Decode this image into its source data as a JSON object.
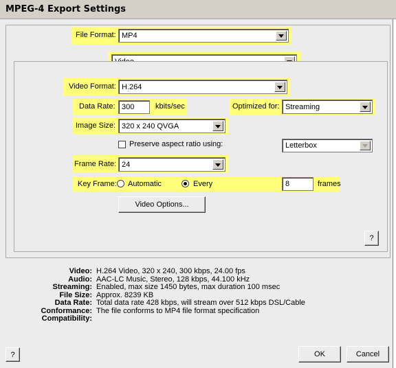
{
  "window": {
    "title": "MPEG-4 Export Settings"
  },
  "file_format": {
    "label": "File Format:",
    "value": "MP4"
  },
  "section": {
    "value": "Video"
  },
  "video_format": {
    "label": "Video Format:",
    "value": "H.264"
  },
  "data_rate": {
    "label": "Data Rate:",
    "value": "300",
    "unit": "kbits/sec"
  },
  "optimized_for": {
    "label": "Optimized for:",
    "value": "Streaming"
  },
  "image_size": {
    "label": "Image Size:",
    "value": "320 x 240 QVGA"
  },
  "preserve_aspect": {
    "label": "Preserve aspect ratio using:",
    "checked": false,
    "value": "Letterbox"
  },
  "frame_rate": {
    "label": "Frame Rate:",
    "value": "24"
  },
  "key_frame": {
    "label": "Key Frame:",
    "automatic": "Automatic",
    "every": "Every",
    "selected": "every",
    "value": "8",
    "unit": "frames"
  },
  "buttons": {
    "video_options": "Video Options...",
    "help": "?",
    "ok": "OK",
    "cancel": "Cancel"
  },
  "summary": [
    {
      "key": "Video:",
      "value": "H.264 Video, 320 x 240, 300 kbps, 24.00 fps"
    },
    {
      "key": "Audio:",
      "value": "AAC-LC Music, Stereo, 128 kbps, 44.100 kHz"
    },
    {
      "key": "Streaming:",
      "value": "Enabled, max size 1450 bytes, max duration 100 msec"
    },
    {
      "key": "File Size:",
      "value": "Approx. 8239 KB"
    },
    {
      "key": "Data Rate:",
      "value": "Total data rate 428 kbps, will stream over 512 kbps DSL/Cable"
    },
    {
      "key": "Conformance:",
      "value": "The file conforms to MP4 file format specification"
    },
    {
      "key": "Compatibility:",
      "value": ""
    }
  ],
  "colors": {
    "highlight": "#ffff7a",
    "dialog_bg": "#ececec"
  }
}
